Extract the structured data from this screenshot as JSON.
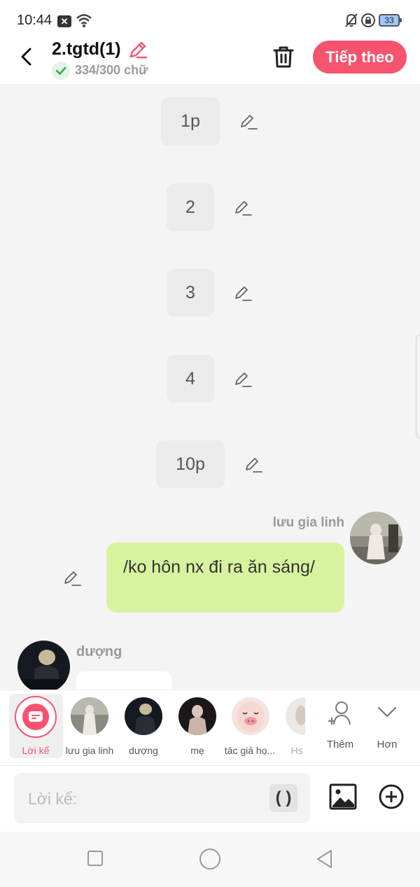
{
  "status_bar": {
    "time": "10:44",
    "battery": "33"
  },
  "header": {
    "title": "2.tgtd(1)",
    "word_count": "334/300 chữ",
    "next_label": "Tiếp theo"
  },
  "narration": [
    {
      "text": "1p"
    },
    {
      "text": "2"
    },
    {
      "text": "3"
    },
    {
      "text": "4"
    },
    {
      "text": "10p"
    }
  ],
  "message_right": {
    "name": "lưu gia linh",
    "text": "/ko hôn nx đi ra ăn sáng/"
  },
  "message_left": {
    "name": "dượng"
  },
  "characters": [
    {
      "label": "Lời kể",
      "selected": true
    },
    {
      "label": "lưu gia linh"
    },
    {
      "label": "dượng"
    },
    {
      "label": "mẹ"
    },
    {
      "label": "tác giả họ..."
    },
    {
      "label": "Hs"
    }
  ],
  "actions": {
    "add_label": "Thêm",
    "more_label": "Hơn"
  },
  "input": {
    "placeholder": "Lời kể:",
    "paren_label": "( )"
  },
  "colors": {
    "accent": "#f7536e",
    "bubble": "#d8f3a0"
  }
}
